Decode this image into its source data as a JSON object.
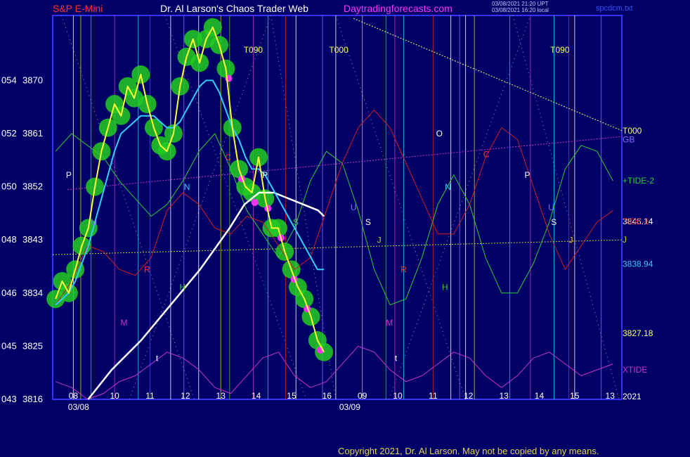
{
  "header": {
    "instrument": "S&P E-Mini",
    "site": "Dr. Al Larson's Chaos Trader Web",
    "url": "Daytradingforecasts.com",
    "stamp1": "03/08/2021 21:20 UPT",
    "stamp2": "03/08/2021 16:20 local",
    "file": "spcdcm.txt"
  },
  "copyright": "Copyright 2021, Dr. Al Larson. May not be copied by any means.",
  "colors": {
    "background": "#000066",
    "frame": "#3333ff",
    "price": "#ffff33",
    "ema_fast": "#33ccff",
    "ema_slow": "#ffffff",
    "tide2": "#33cc33",
    "tide1": "#cc2222",
    "xtide": "#cc33cc",
    "bubble": "#22cc22",
    "magenta_dot": "#ff33ff"
  },
  "chart_data": {
    "type": "line",
    "title": "S&P E-Mini",
    "ylim": [
      3816,
      3881
    ],
    "left_axis": [
      {
        "bubble": "043",
        "price": "3816"
      },
      {
        "bubble": "045",
        "price": "3825"
      },
      {
        "bubble": "046",
        "price": "3834"
      },
      {
        "bubble": "048",
        "price": "3843"
      },
      {
        "bubble": "050",
        "price": "3852"
      },
      {
        "bubble": "052",
        "price": "3861"
      },
      {
        "bubble": "054",
        "price": "3870"
      }
    ],
    "x_hours": [
      {
        "label": "08",
        "t": 0.7
      },
      {
        "label": "10",
        "t": 2.1
      },
      {
        "label": "11",
        "t": 3.3
      },
      {
        "label": "12",
        "t": 4.5
      },
      {
        "label": "13",
        "t": 5.7
      },
      {
        "label": "14",
        "t": 6.9
      },
      {
        "label": "15",
        "t": 8.1
      },
      {
        "label": "16",
        "t": 9.3
      },
      {
        "label": "09",
        "t": 10.5
      },
      {
        "label": "10",
        "t": 11.7
      },
      {
        "label": "11",
        "t": 12.9
      },
      {
        "label": "12",
        "t": 14.1
      },
      {
        "label": "13",
        "t": 15.3
      },
      {
        "label": "14",
        "t": 16.5
      },
      {
        "label": "15",
        "t": 17.7
      },
      {
        "label": "13",
        "t": 18.9
      }
    ],
    "dates": [
      {
        "label": "03/08",
        "t": 0.4
      },
      {
        "label": "03/09",
        "t": 9.6
      }
    ],
    "right_labels": [
      {
        "text": "T000",
        "value": 3861.5,
        "color": "#ffff66"
      },
      {
        "text": "GB",
        "value": 3860.0,
        "color": "#8a6bff"
      },
      {
        "text": "+TIDE-2",
        "value": 3853.0,
        "color": "#33cc33"
      },
      {
        "text": "3846.14",
        "value": 3846.14,
        "color": "#ffffff"
      },
      {
        "text": "TIDE-1",
        "value": 3846.1,
        "color": "#cc2222"
      },
      {
        "text": "J",
        "value": 3843.0,
        "color": "#cccc33"
      },
      {
        "text": "3838.94",
        "value": 3838.94,
        "color": "#33ccff"
      },
      {
        "text": "3827.18",
        "value": 3827.18,
        "color": "#ffff66"
      },
      {
        "text": "XTIDE",
        "value": 3821.0,
        "color": "#cc33cc"
      },
      {
        "text": "2021",
        "value": 3816.5,
        "color": "#ffffff"
      }
    ],
    "top_markers": [
      {
        "text": "T090",
        "t": 6.8
      },
      {
        "text": "T000",
        "t": 9.7
      },
      {
        "text": "T090",
        "t": 17.2
      }
    ],
    "letters": [
      {
        "text": "P",
        "t": 0.45,
        "value": 3853.5,
        "color": "#ffffff"
      },
      {
        "text": "U",
        "t": 1.3,
        "value": 3845.5,
        "color": "#8a6bff"
      },
      {
        "text": "N",
        "t": 4.45,
        "value": 3851.5,
        "color": "#33ccff"
      },
      {
        "text": "C",
        "t": 5.85,
        "value": 3856.5,
        "color": "#ff3333"
      },
      {
        "text": "P",
        "t": 7.1,
        "value": 3853.5,
        "color": "#ffffff"
      },
      {
        "text": "S",
        "t": 8.15,
        "value": 3845.5,
        "color": "#33cc33"
      },
      {
        "text": "R",
        "t": 3.1,
        "value": 3837.5,
        "color": "#ff3333"
      },
      {
        "text": "H",
        "t": 4.3,
        "value": 3834.5,
        "color": "#33cc33"
      },
      {
        "text": "M",
        "t": 2.3,
        "value": 3828.5,
        "color": "#cc33cc"
      },
      {
        "text": "t",
        "t": 3.5,
        "value": 3822.5,
        "color": "#ffffff"
      },
      {
        "text": "U",
        "t": 10.1,
        "value": 3848.0,
        "color": "#8a6bff"
      },
      {
        "text": "S",
        "t": 10.6,
        "value": 3845.5,
        "color": "#ffffff"
      },
      {
        "text": "J",
        "t": 11.0,
        "value": 3842.5,
        "color": "#cccc33"
      },
      {
        "text": "R",
        "t": 11.8,
        "value": 3837.5,
        "color": "#ff3333"
      },
      {
        "text": "M",
        "t": 11.3,
        "value": 3828.5,
        "color": "#cc33cc"
      },
      {
        "text": "t",
        "t": 11.6,
        "value": 3822.5,
        "color": "#ffffff"
      },
      {
        "text": "O",
        "t": 13.0,
        "value": 3860.5,
        "color": "#ffffff"
      },
      {
        "text": "N",
        "t": 13.3,
        "value": 3851.5,
        "color": "#33ccff"
      },
      {
        "text": "H",
        "t": 13.2,
        "value": 3834.5,
        "color": "#33cc33"
      },
      {
        "text": "C",
        "t": 14.6,
        "value": 3857.0,
        "color": "#ff3333"
      },
      {
        "text": "P",
        "t": 16.0,
        "value": 3853.5,
        "color": "#ffffff"
      },
      {
        "text": "U",
        "t": 16.8,
        "value": 3848.0,
        "color": "#8a6bff"
      },
      {
        "text": "S",
        "t": 16.9,
        "value": 3845.5,
        "color": "#ffffff"
      },
      {
        "text": "J",
        "t": 17.5,
        "value": 3842.5,
        "color": "#cccc33"
      }
    ],
    "price": [
      3833,
      3836,
      3834,
      3838,
      3842,
      3845,
      3852,
      3858,
      3862,
      3866,
      3864,
      3869,
      3867,
      3871,
      3866,
      3862,
      3859,
      3858,
      3861,
      3869,
      3874,
      3877,
      3873,
      3877,
      3879,
      3876,
      3872,
      3862,
      3855,
      3852,
      3851,
      3857,
      3850,
      3845,
      3845,
      3841,
      3838,
      3835,
      3833,
      3830,
      3826,
      3824
    ],
    "ema_fast": [
      3832,
      3833,
      3834,
      3836,
      3839,
      3842,
      3846,
      3850,
      3854,
      3858,
      3861,
      3862,
      3863,
      3864,
      3864,
      3864,
      3863,
      3862,
      3862,
      3863,
      3865,
      3867,
      3869,
      3870,
      3870,
      3868,
      3865,
      3862,
      3860,
      3857,
      3855,
      3855,
      3854,
      3852,
      3850,
      3848,
      3846,
      3844,
      3842,
      3840,
      3838,
      3838
    ],
    "ema_slow_t": [
      1.2,
      2.0,
      3.0,
      4.0,
      5.0,
      6.0,
      6.5,
      7.0,
      7.5,
      8.0,
      8.5,
      9.0,
      9.2
    ],
    "ema_slow": [
      3816,
      3821,
      3826,
      3832,
      3838,
      3845,
      3849,
      3851,
      3851,
      3850,
      3849,
      3848,
      3847
    ],
    "tide2": [
      3858,
      3861,
      3859,
      3857,
      3853,
      3850,
      3847,
      3849,
      3853,
      3858,
      3861,
      3855,
      3848,
      3844,
      3840,
      3845,
      3853,
      3858,
      3856,
      3848,
      3838,
      3832,
      3833,
      3840,
      3849,
      3854,
      3849,
      3840,
      3834,
      3834,
      3839,
      3846,
      3855,
      3859,
      3858,
      3853
    ],
    "tide1": [
      3832,
      3836,
      3842,
      3841,
      3838,
      3837,
      3840,
      3848,
      3851,
      3849,
      3845,
      3844,
      3847,
      3846,
      3842,
      3838,
      3840,
      3848,
      3856,
      3862,
      3865,
      3862,
      3856,
      3850,
      3844,
      3844,
      3849,
      3857,
      3862,
      3860,
      3852,
      3844,
      3838,
      3842,
      3846,
      3848
    ],
    "xtide": [
      3819,
      3818,
      3816,
      3817,
      3819,
      3820,
      3822,
      3824,
      3823,
      3821,
      3818,
      3817,
      3820,
      3823,
      3824,
      3820,
      3818,
      3819,
      3822,
      3825,
      3824,
      3821,
      3819,
      3820,
      3822,
      3824,
      3823,
      3820,
      3818,
      3820,
      3823,
      3824,
      3822,
      3820,
      3821,
      3822
    ],
    "reference_lines": [
      {
        "name": "GB",
        "from": [
          0.5,
          3851.5
        ],
        "to": [
          19.3,
          3860.5
        ],
        "color": "#cc33cc"
      },
      {
        "name": "J",
        "from": [
          0.0,
          3840.5
        ],
        "to": [
          19.3,
          3843.0
        ],
        "color": "#cccc33"
      },
      {
        "name": "T000",
        "from": [
          10.2,
          3880.5
        ],
        "to": [
          19.3,
          3861.5
        ],
        "color": "#ffff66"
      }
    ],
    "vertical_lines_t": [
      0.7,
      0.95,
      1.3,
      2.1,
      2.9,
      3.3,
      4.0,
      4.45,
      4.95,
      5.7,
      6.0,
      6.8,
      7.3,
      7.9,
      8.25,
      9.15,
      9.6,
      10.5,
      11.3,
      11.6,
      11.9,
      12.9,
      13.5,
      13.8,
      14.0,
      14.3,
      15.5,
      16.2,
      17.0,
      17.5,
      17.7,
      18.6
    ]
  }
}
